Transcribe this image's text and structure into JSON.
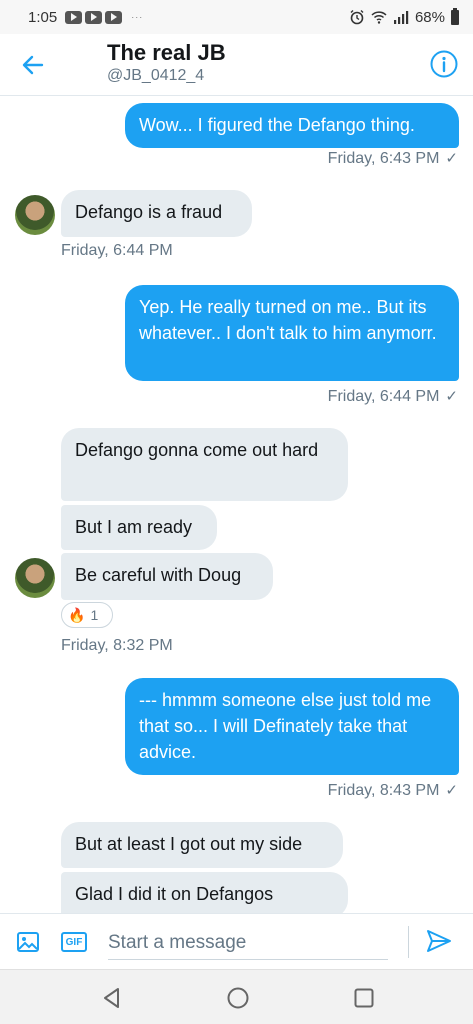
{
  "status_bar": {
    "time": "1:05",
    "dots": "···",
    "battery": "68%"
  },
  "header": {
    "title": "The real JB",
    "handle": "@JB_0412_4"
  },
  "messages": [
    {
      "type": "sent",
      "text": "Wow... I figured the Defango thing."
    },
    {
      "type": "ts_sent",
      "text": "Friday, 6:43 PM"
    },
    {
      "type": "recv",
      "text": "Defango is a fraud"
    },
    {
      "type": "ts_recv",
      "text": "Friday, 6:44 PM"
    },
    {
      "type": "sent",
      "text": "Yep.   He really turned on me.. But its whatever.. I don't talk to him anymorr."
    },
    {
      "type": "ts_sent",
      "text": "Friday, 6:44 PM"
    },
    {
      "type": "recv",
      "text": "Defango gonna come out hard"
    },
    {
      "type": "recv",
      "text": "But I am ready"
    },
    {
      "type": "recv",
      "text": "Be careful with Doug"
    },
    {
      "type": "reaction",
      "emoji": "🔥",
      "count": "1"
    },
    {
      "type": "ts_recv",
      "text": "Friday, 8:32 PM"
    },
    {
      "type": "sent",
      "text": "--- hmmm someone else just told me that so... I will Definately take that advice."
    },
    {
      "type": "ts_sent",
      "text": "Friday, 8:43 PM"
    },
    {
      "type": "recv",
      "text": "But at least I got out my side"
    },
    {
      "type": "recv",
      "text": "Glad I did it on Defangos"
    }
  ],
  "check_mark": "✓",
  "composer": {
    "placeholder": "Start a message",
    "gif_label": "GIF"
  },
  "colors": {
    "accent": "#1da1f2",
    "received_bubble": "#e6ecf0",
    "timestamp": "#657786"
  }
}
